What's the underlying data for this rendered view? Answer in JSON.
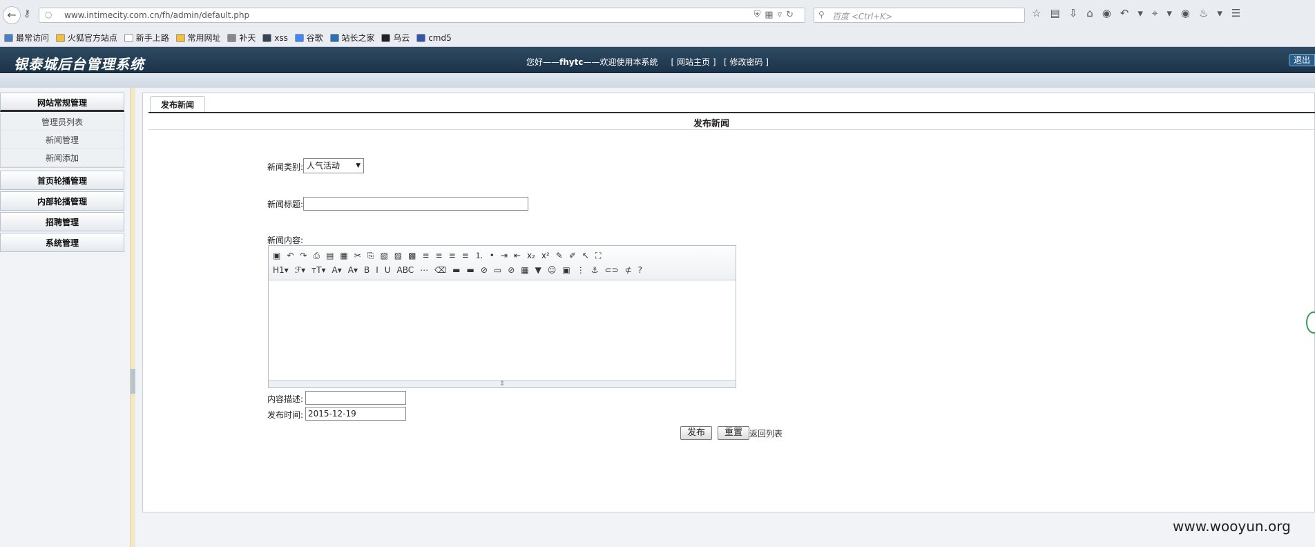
{
  "browser": {
    "url": "www.intimecity.com.cn/fh/admin/default.php",
    "search_placeholder": "百度 <Ctrl+K>",
    "bookmarks": [
      {
        "label": "最常访问",
        "color": "#4a7fc1"
      },
      {
        "label": "火狐官方站点",
        "color": "#f0c040"
      },
      {
        "label": "新手上路",
        "color": "#ffffff"
      },
      {
        "label": "常用网址",
        "color": "#f0c040"
      },
      {
        "label": "补天",
        "color": "#888888"
      },
      {
        "label": "xss",
        "color": "#334455"
      },
      {
        "label": "谷歌",
        "color": "#4285f4"
      },
      {
        "label": "站长之家",
        "color": "#2a6fb0"
      },
      {
        "label": "乌云",
        "color": "#222222"
      },
      {
        "label": "cmd5",
        "color": "#3355aa"
      }
    ]
  },
  "header": {
    "title": "银泰城后台管理系统",
    "welcome_prefix": "您好——",
    "username": "fhytc",
    "welcome_suffix": "——欢迎使用本系统",
    "site_home": "[ 网站主页 ]",
    "change_password": "[ 修改密码 ]",
    "logout": "退出"
  },
  "sidebar": {
    "groups": [
      {
        "label": "网站常规管理",
        "items": [
          "管理员列表",
          "新闻管理",
          "新闻添加"
        ]
      },
      {
        "label": "首页轮播管理"
      },
      {
        "label": "内部轮播管理"
      },
      {
        "label": "招聘管理"
      },
      {
        "label": "系统管理"
      }
    ]
  },
  "main": {
    "tab": "发布新闻",
    "form_title": "发布新闻",
    "category_label": "新闻类别:",
    "category_value": "人气活动",
    "title_label": "新闻标题:",
    "content_label": "新闻内容:",
    "toolbar_row1": [
      "▣",
      "↶",
      "↷",
      "⎙",
      "▤",
      "▦",
      "✂",
      "⎘",
      "▧",
      "▨",
      "▩",
      "≡",
      "≡",
      "≡",
      "≡",
      "⒈",
      "•",
      "⇥",
      "⇤",
      "x₂",
      "x²",
      "✎",
      "✐",
      "↖",
      "⛶"
    ],
    "toolbar_row2": [
      "H1▾",
      "ℱ▾",
      "тT▾",
      "A▾",
      "A▾",
      "B",
      "I",
      "U",
      "ABC",
      "⋯",
      "⌫",
      "▬",
      "▬",
      "⊘",
      "▭",
      "⊘",
      "▦",
      "▼",
      "☺",
      "▣",
      "⋮",
      "⚓",
      "⊂⊃",
      "⊄",
      "?"
    ],
    "desc_label": "内容描述:",
    "date_label": "发布时间:",
    "date_value": "2015-12-19",
    "publish": "发布",
    "reset": "重置",
    "back": "返回列表"
  },
  "watermark": "www.wooyun.org"
}
